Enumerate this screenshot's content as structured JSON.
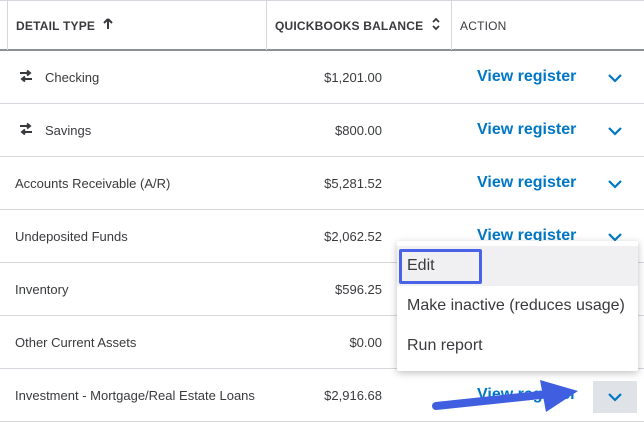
{
  "header": {
    "detail_type": "DETAIL TYPE",
    "detail_sort_icon": "arrow-up-icon",
    "balance": "QUICKBOOKS BALANCE",
    "balance_sort_icon": "sort-updown-icon",
    "action": "ACTION"
  },
  "rows": [
    {
      "detail": "Checking",
      "balance": "$1,201.00",
      "action": "View register",
      "transfer_icon": true
    },
    {
      "detail": "Savings",
      "balance": "$800.00",
      "action": "View register",
      "transfer_icon": true
    },
    {
      "detail": "Accounts Receivable (A/R)",
      "balance": "$5,281.52",
      "action": "View register",
      "transfer_icon": false
    },
    {
      "detail": "Undeposited Funds",
      "balance": "$2,062.52",
      "action": "View register",
      "transfer_icon": false
    },
    {
      "detail": "Inventory",
      "balance": "$596.25",
      "action": "",
      "transfer_icon": false
    },
    {
      "detail": "Other Current Assets",
      "balance": "$0.00",
      "action": "",
      "transfer_icon": false
    },
    {
      "detail": "Investment - Mortgage/Real Estate Loans",
      "balance": "$2,916.68",
      "action": "View register",
      "transfer_icon": false
    }
  ],
  "dropdown_menu": {
    "items": [
      "Edit",
      "Make inactive (reduces usage)",
      "Run report"
    ]
  },
  "colors": {
    "link": "#0077c5",
    "highlight_box": "#4a63e6",
    "arrow": "#3f5ee0"
  }
}
